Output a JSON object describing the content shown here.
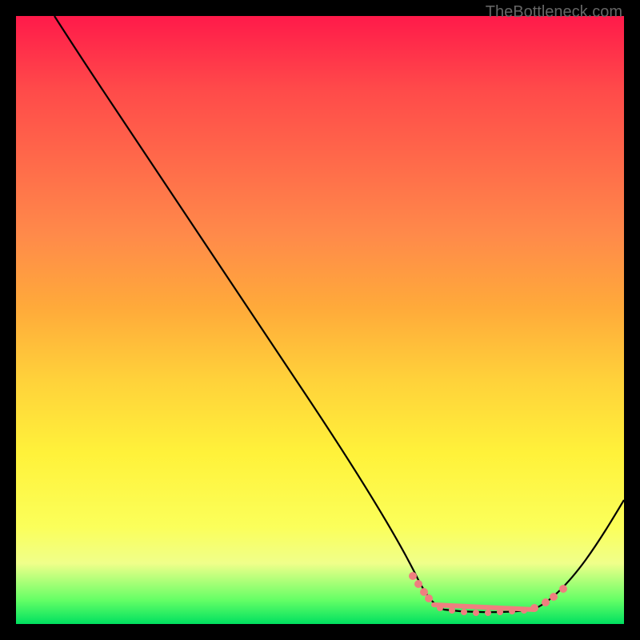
{
  "watermark": "TheBottleneck.com",
  "chart_data": {
    "type": "line",
    "title": "",
    "xlabel": "",
    "ylabel": "",
    "ylim": [
      0,
      100
    ],
    "x": [
      0,
      3,
      5,
      10,
      15,
      20,
      25,
      30,
      35,
      40,
      45,
      50,
      55,
      60,
      63,
      66,
      69,
      72,
      75,
      78,
      81,
      84,
      87,
      90,
      93,
      96,
      100
    ],
    "values": [
      100,
      97,
      95,
      88,
      80,
      72,
      64,
      56,
      48,
      40,
      32,
      24,
      16,
      8,
      4,
      2,
      1,
      0.5,
      0.5,
      0.5,
      1,
      2,
      3.5,
      6,
      9.5,
      14,
      20
    ],
    "sweet_spot_range_x": [
      63,
      90
    ],
    "marker_points_x": [
      63,
      64,
      65,
      68,
      70,
      72,
      74,
      76,
      78,
      80,
      82,
      84,
      86,
      88,
      90
    ],
    "background_gradient": {
      "top": "#ff1a4a",
      "mid": "#ffd23a",
      "bottom": "#00e060"
    }
  }
}
